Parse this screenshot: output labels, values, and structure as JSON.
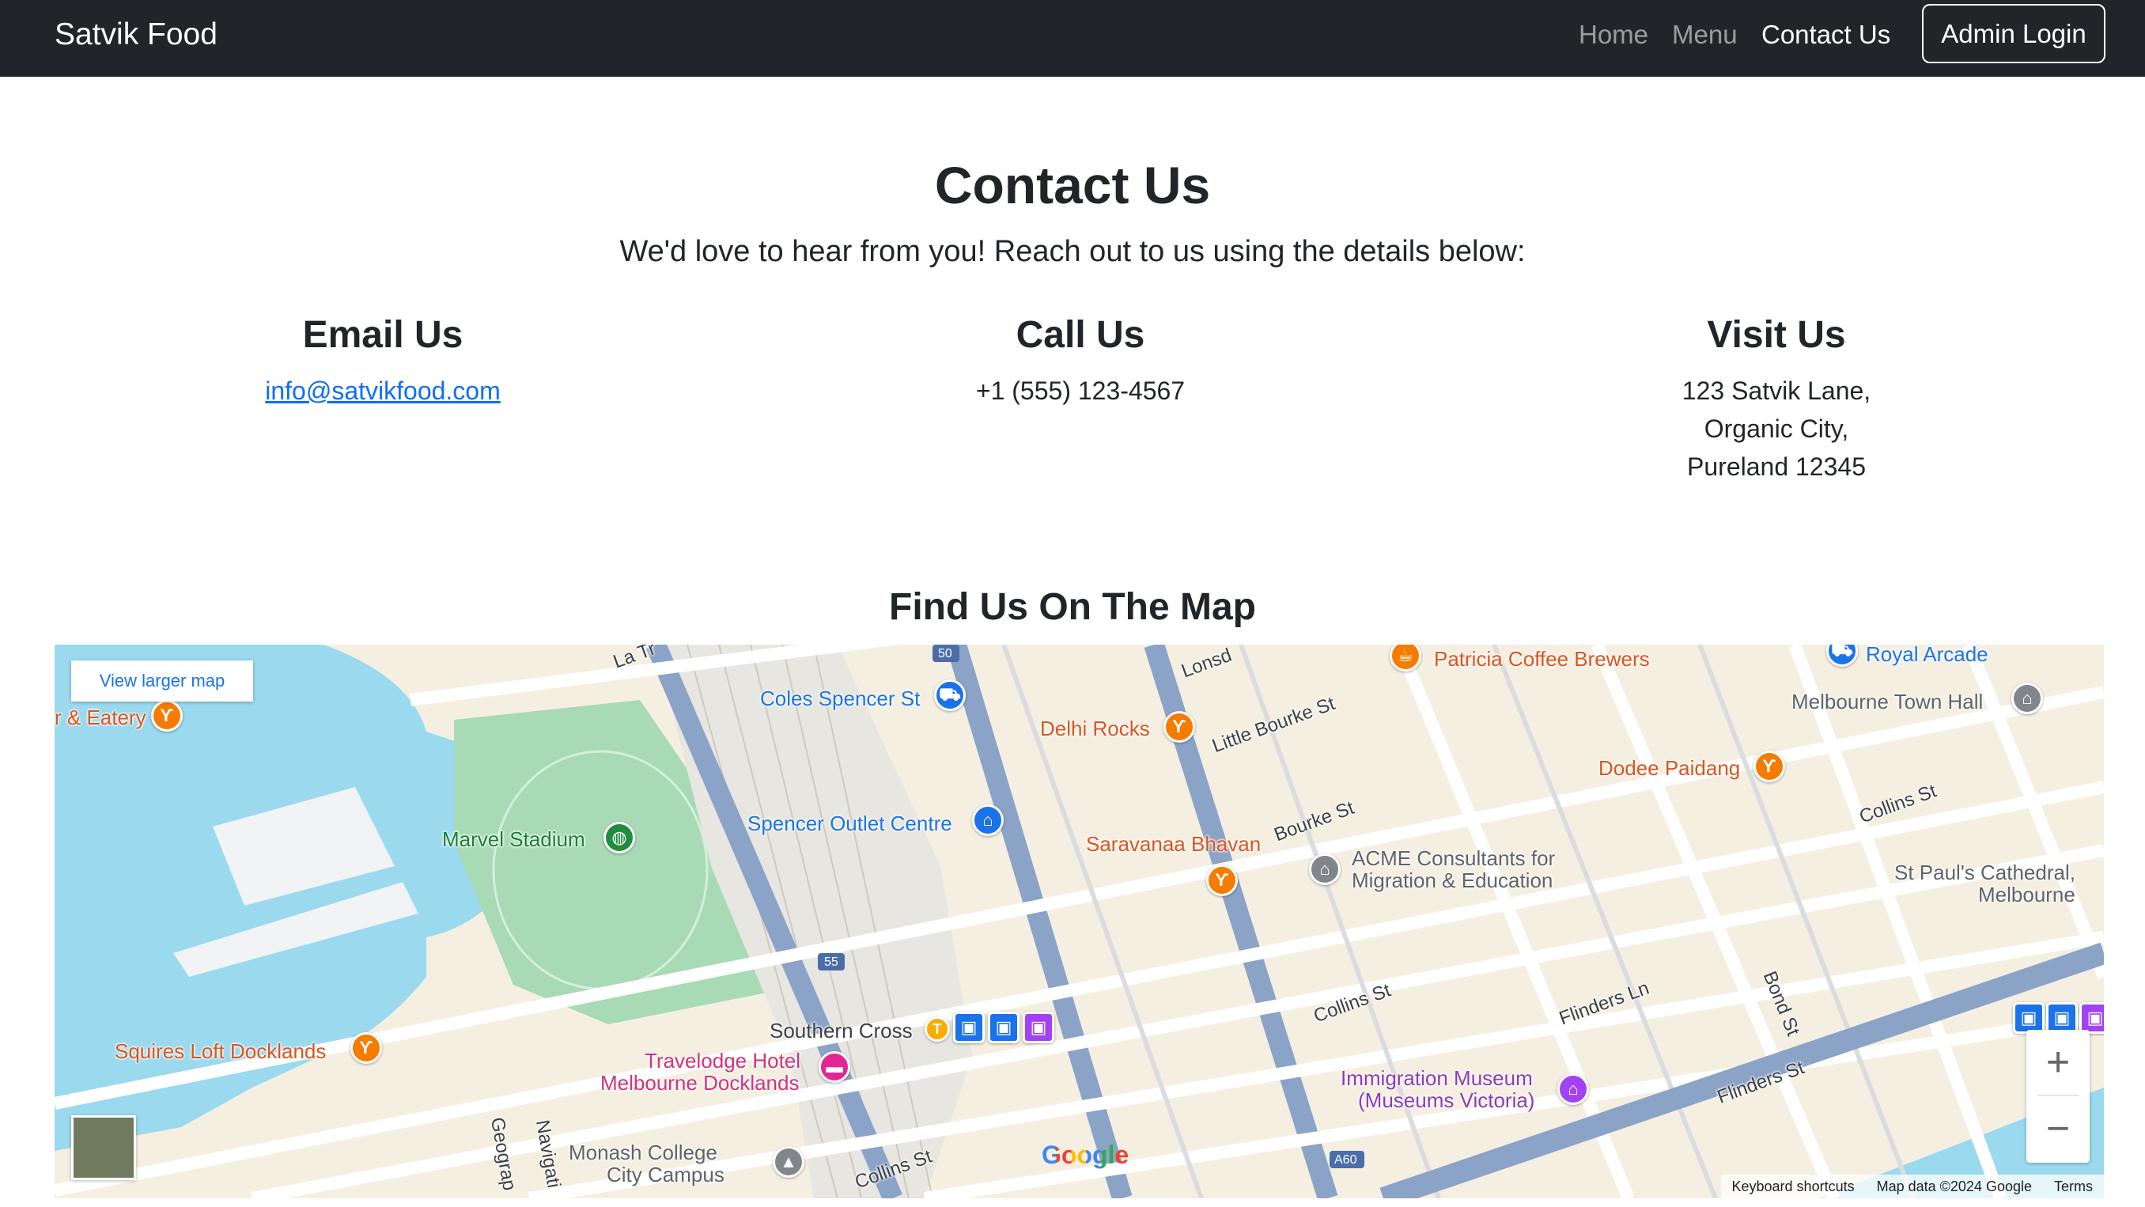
{
  "navbar": {
    "brand": "Satvik Food",
    "links": {
      "home": "Home",
      "menu": "Menu",
      "contact": "Contact Us"
    },
    "admin_button": "Admin Login"
  },
  "hero": {
    "title": "Contact Us",
    "lead": "We'd love to hear from you! Reach out to us using the details below:"
  },
  "contact": {
    "email": {
      "heading": "Email Us",
      "value": "info@satvikfood.com"
    },
    "call": {
      "heading": "Call Us",
      "value": "+1 (555) 123-4567"
    },
    "visit": {
      "heading": "Visit Us",
      "line1": "123 Satvik Lane,",
      "line2": "Organic City,",
      "line3": "Pureland 12345"
    }
  },
  "map_section": {
    "title": "Find Us On The Map",
    "view_larger": "View larger map",
    "zoom_in": "+",
    "zoom_out": "−",
    "google": "Google",
    "footer": {
      "shortcuts": "Keyboard shortcuts",
      "data": "Map data ©2024 Google",
      "terms": "Terms"
    },
    "places": {
      "eatery": "r & Eatery",
      "coles": "Coles Spencer St",
      "delhi": "Delhi Rocks",
      "patricia": "Patricia Coffee Brewers",
      "royal": "Royal Arcade",
      "town_hall": "Melbourne Town Hall",
      "dodee": "Dodee Paidang",
      "marvel": "Marvel Stadium",
      "spencer_outlet": "Spencer Outlet Centre",
      "saravanaa": "Saravanaa Bhavan",
      "acme_1": "ACME Consultants for",
      "acme_2": "Migration & Education",
      "st_pauls_1": "St Paul's Cathedral,",
      "st_pauls_2": "Melbourne",
      "squires": "Squires Loft Docklands",
      "southern_cross": "Southern Cross",
      "travelodge_1": "Travelodge Hotel",
      "travelodge_2": "Melbourne Docklands",
      "immigration_1": "Immigration Museum",
      "immigration_2": "(Museums Victoria)",
      "monash_1": "Monash College",
      "monash_2": "City Campus"
    },
    "streets": {
      "little_bourke": "Little Bourke St",
      "bourke": "Bourke St",
      "collins_e": "Collins St",
      "collins_mid": "Collins St",
      "collins_sw": "Collins St",
      "flinders_ln": "Flinders Ln",
      "flinders_st": "Flinders St",
      "bond": "Bond St",
      "lonsdale": "Lonsd",
      "la_trobe": "La Tr",
      "geography": "Geograp",
      "navigation": "Navigati",
      "route_50": "50",
      "route_55": "55",
      "route_a60": "A60"
    }
  }
}
